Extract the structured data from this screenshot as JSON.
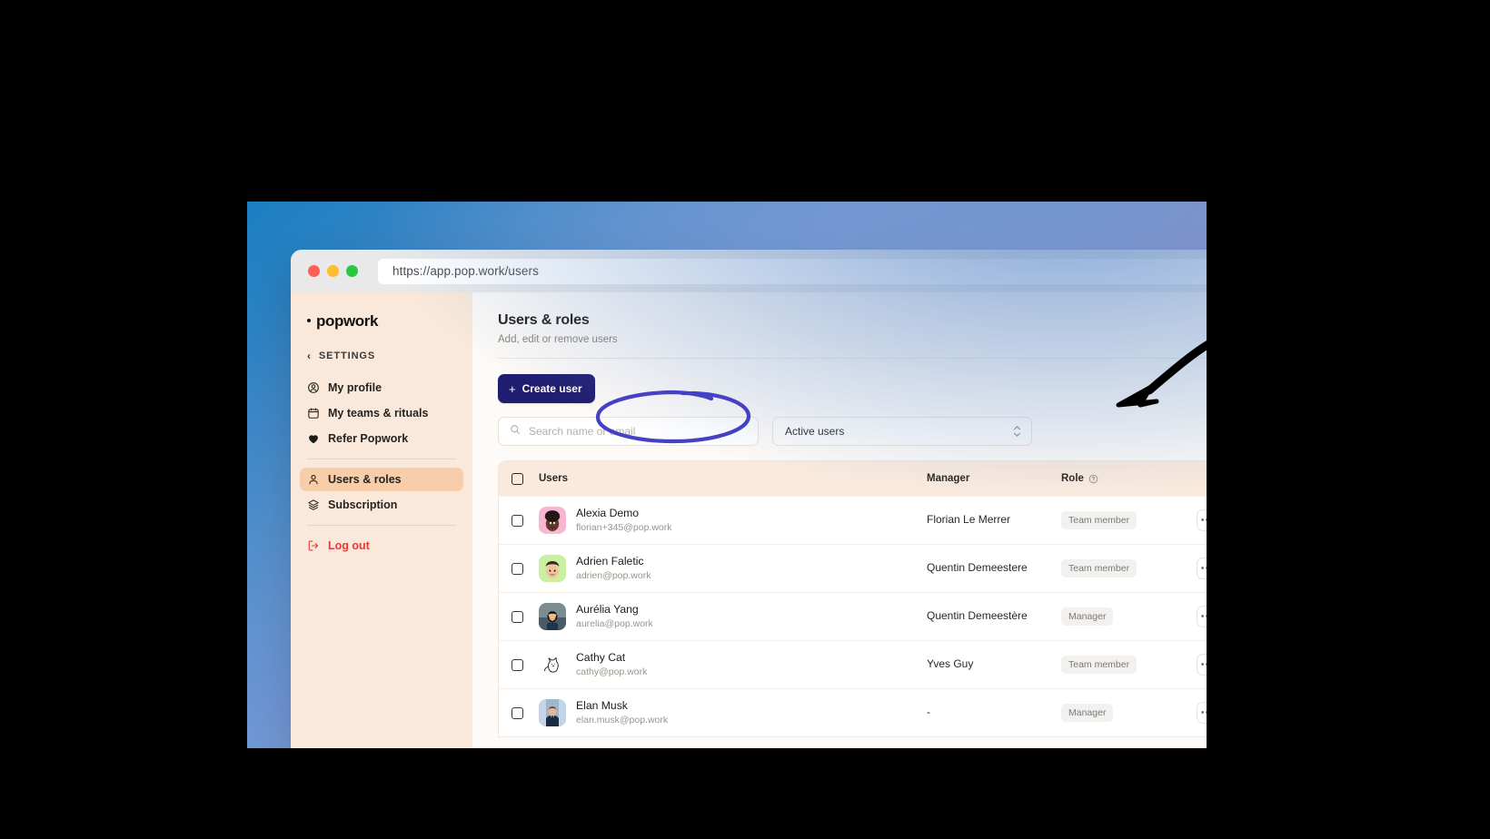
{
  "browser": {
    "url": "https://app.pop.work/users",
    "traffic_lights": [
      "close-red",
      "minimize-yellow",
      "maximize-green"
    ]
  },
  "sidebar": {
    "logo": "popwork",
    "back_label": "SETTINGS",
    "items": [
      {
        "label": "My profile",
        "icon": "user-circle-icon",
        "active": false
      },
      {
        "label": "My teams & rituals",
        "icon": "calendar-icon",
        "active": false
      },
      {
        "label": "Refer Popwork",
        "icon": "heart-icon",
        "active": false
      },
      {
        "label": "Users & roles",
        "icon": "user-icon",
        "active": true
      },
      {
        "label": "Subscription",
        "icon": "layers-icon",
        "active": false
      }
    ],
    "logout": {
      "label": "Log out",
      "icon": "logout-icon",
      "color": "#E23B3B"
    }
  },
  "main": {
    "title": "Users & roles",
    "subtitle": "Add, edit or remove users",
    "create_button": "Create user",
    "create_button_icon": "plus-icon",
    "search": {
      "value": "",
      "placeholder": "Search name or email",
      "icon": "search-icon"
    },
    "status_filter": {
      "selected": "Active users",
      "icon": "chevron-updown-icon"
    },
    "table": {
      "columns": [
        "Users",
        "Manager",
        "Role"
      ],
      "role_help_icon": "question-circle-icon",
      "select_all_checked": false,
      "rows": [
        {
          "name": "Alexia Demo",
          "email": "florian+345@pop.work",
          "manager": "Florian Le Merrer",
          "role": "Team member",
          "avatar": "avatar-alexia",
          "checked": false
        },
        {
          "name": "Adrien Faletic",
          "email": "adrien@pop.work",
          "manager": "Quentin Demeestere",
          "role": "Team member",
          "avatar": "avatar-adrien",
          "checked": false
        },
        {
          "name": "Aurélia Yang",
          "email": "aurelia@pop.work",
          "manager": "Quentin Demeestère",
          "role": "Manager",
          "avatar": "avatar-aurelia",
          "checked": false
        },
        {
          "name": "Cathy Cat",
          "email": "cathy@pop.work",
          "manager": "Yves Guy",
          "role": "Team member",
          "avatar": "avatar-cathy",
          "checked": false
        },
        {
          "name": "Elan Musk",
          "email": "elan.musk@pop.work",
          "manager": "-",
          "role": "Manager",
          "avatar": "avatar-elan",
          "checked": false
        }
      ],
      "row_action_label": "•••"
    }
  },
  "annotations": [
    {
      "type": "ellipse",
      "color": "#4541C4",
      "target": "search-input"
    },
    {
      "type": "arrow",
      "color": "#000000",
      "target": "status-filter-select"
    }
  ]
}
